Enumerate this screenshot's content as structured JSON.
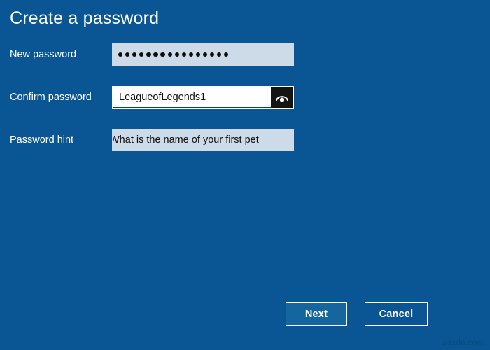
{
  "page": {
    "title": "Create a password",
    "background_color": "#0a5694"
  },
  "form": {
    "fields": [
      {
        "label": "New password",
        "type": "password",
        "masked": true,
        "mask_dot_count": 16,
        "value": "LeagueofLegends1",
        "display_value": "●●●●●●●●●●●●●●●●",
        "placeholder": "",
        "focused": false,
        "has_reveal_button": false
      },
      {
        "label": "Confirm password",
        "type": "text",
        "masked": false,
        "value": "LeagueofLegends1",
        "display_value": "LeagueofLegends1",
        "placeholder": "",
        "focused": true,
        "has_reveal_button": true,
        "reveal_icon": "eye-icon"
      },
      {
        "label": "Password hint",
        "type": "text",
        "masked": false,
        "value": "What is the name of your first pet",
        "display_value": "What is the name of your first pet",
        "placeholder": "",
        "focused": false,
        "text_clipped_left": true,
        "has_reveal_button": false
      }
    ]
  },
  "footer": {
    "next_label": "Next",
    "cancel_label": "Cancel",
    "primary_color": "#15669f"
  },
  "watermark": {
    "text": "wsxdn.com"
  }
}
